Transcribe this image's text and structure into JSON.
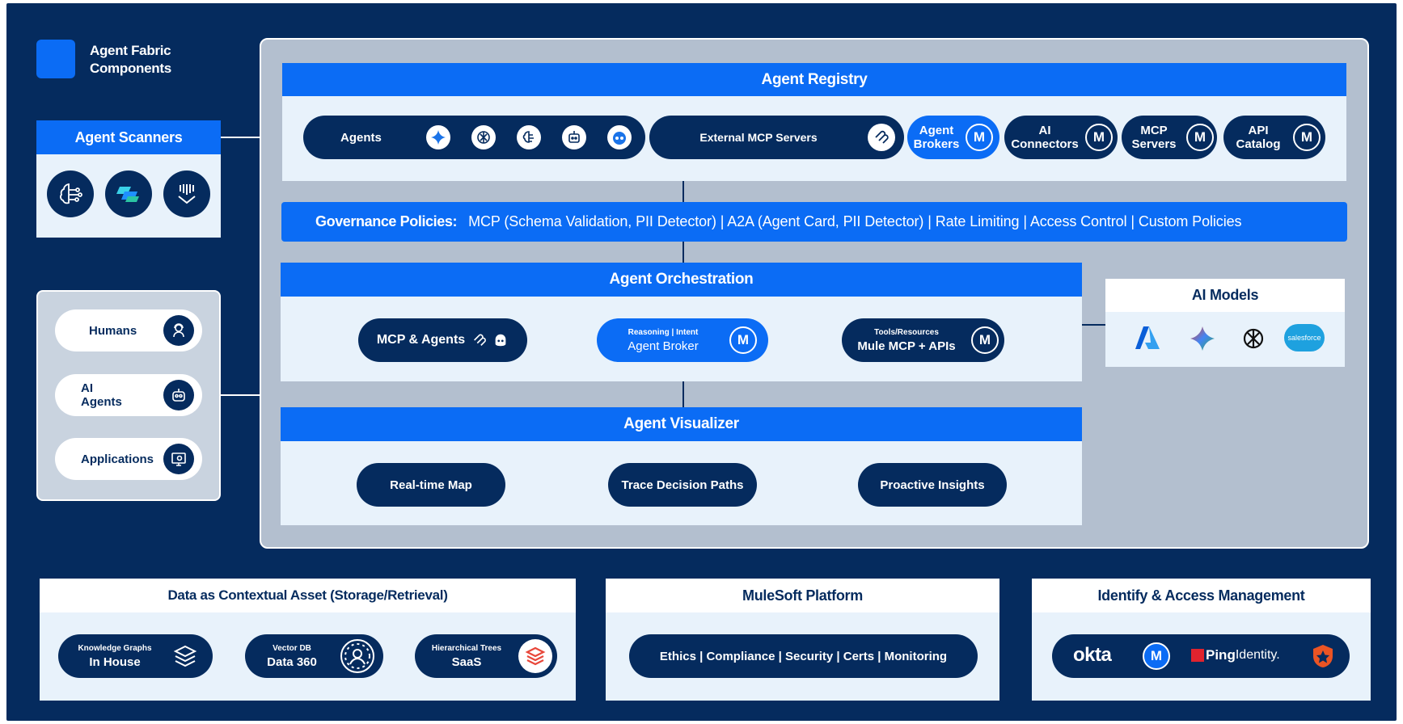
{
  "legend": {
    "label_line1": "Agent Fabric",
    "label_line2": "Components",
    "swatch_color": "#0b6cf5"
  },
  "scanners": {
    "title": "Agent Scanners",
    "icons": [
      "brain-circuit-icon",
      "copilot-icon",
      "databricks-icon"
    ]
  },
  "actors": [
    {
      "label": "Humans",
      "icon": "person-headset-icon"
    },
    {
      "label_line1": "AI",
      "label_line2": "Agents",
      "icon": "robot-icon"
    },
    {
      "label": "Applications",
      "icon": "app-gear-icon"
    }
  ],
  "registry": {
    "title": "Agent Registry",
    "agents_label": "Agents",
    "agent_icons": [
      "gemini-icon",
      "openai-icon",
      "brain-icon",
      "robot-icon",
      "github-copilot-icon"
    ],
    "external_mcp": "External MCP Servers",
    "brokers": {
      "line1": "Agent",
      "line2": "Brokers"
    },
    "connectors": {
      "line1": "AI",
      "line2": "Connectors"
    },
    "mcp_servers": {
      "line1": "MCP",
      "line2": "Servers"
    },
    "api_catalog": {
      "line1": "API",
      "line2": "Catalog"
    }
  },
  "governance": {
    "label": "Governance Policies:",
    "text": "MCP (Schema Validation, PII Detector) | A2A (Agent Card, PII Detector) | Rate Limiting | Access Control | Custom Policies"
  },
  "orchestration": {
    "title": "Agent Orchestration",
    "mcp_agents": "MCP & Agents",
    "broker_small": "Reasoning | Intent",
    "broker": "Agent Broker",
    "tools_small": "Tools/Resources",
    "tools": "Mule MCP + APIs"
  },
  "ai_models": {
    "title": "AI Models",
    "icons": [
      "azure-icon",
      "gemini-icon",
      "openai-icon",
      "salesforce-icon"
    ],
    "salesforce_text": "salesforce"
  },
  "visualizer": {
    "title": "Agent Visualizer",
    "items": [
      "Real-time Map",
      "Trace Decision Paths",
      "Proactive Insights"
    ]
  },
  "data_assets": {
    "title": "Data as Contextual Asset (Storage/Retrieval)",
    "items": [
      {
        "small": "Knowledge Graphs",
        "main": "In House"
      },
      {
        "small": "Vector DB",
        "main": "Data 360"
      },
      {
        "small": "Hierarchical Trees",
        "main": "SaaS"
      }
    ]
  },
  "mulesoft": {
    "title": "MuleSoft Platform",
    "text": "Ethics | Compliance | Security | Certs | Monitoring"
  },
  "iam": {
    "title": "Identify & Access Management",
    "okta": "okta",
    "ping_bold": "Ping",
    "ping_light": "Identity."
  },
  "colors": {
    "navy": "#052b5e",
    "blue": "#0b6cf5",
    "light": "#e8f2fb",
    "panel": "#b3bfcf"
  },
  "mule_letter": "M"
}
